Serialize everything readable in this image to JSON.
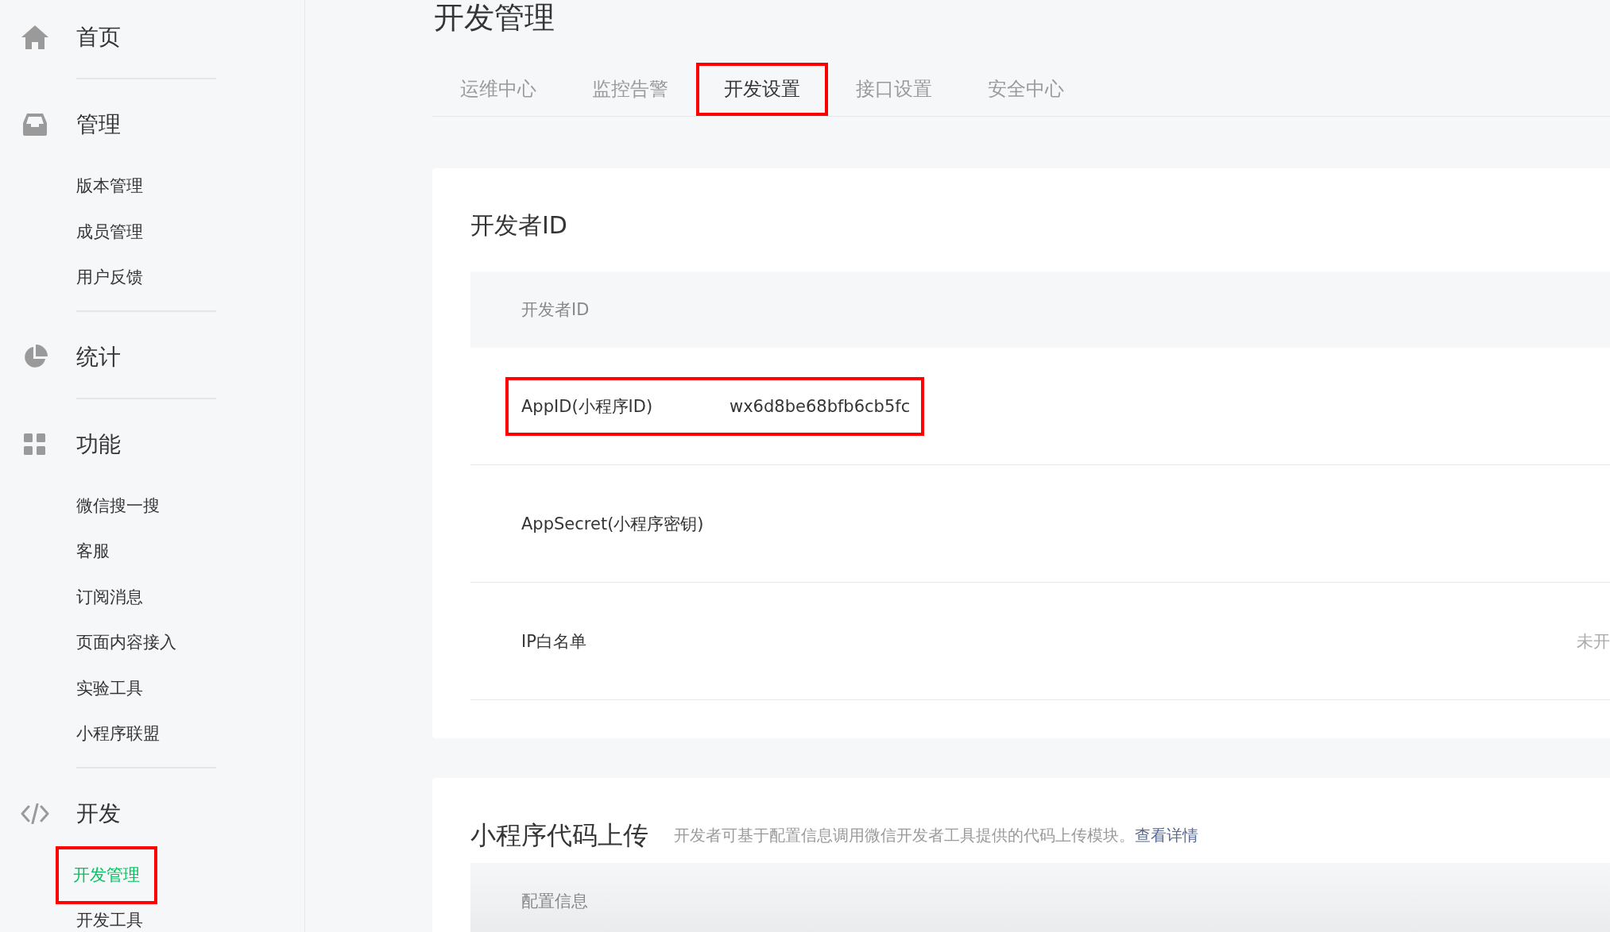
{
  "sidebar": {
    "groups": [
      {
        "title": "首页",
        "kind": "home"
      },
      {
        "title": "管理",
        "kind": "inbox",
        "items": [
          {
            "label": "版本管理",
            "selected": false,
            "highlighted": false
          },
          {
            "label": "成员管理",
            "selected": false,
            "highlighted": false
          },
          {
            "label": "用户反馈",
            "selected": false,
            "highlighted": false
          }
        ]
      },
      {
        "title": "统计",
        "kind": "pie"
      },
      {
        "title": "功能",
        "kind": "grid",
        "items": [
          {
            "label": "微信搜一搜",
            "selected": false,
            "highlighted": false
          },
          {
            "label": "客服",
            "selected": false,
            "highlighted": false
          },
          {
            "label": "订阅消息",
            "selected": false,
            "highlighted": false
          },
          {
            "label": "页面内容接入",
            "selected": false,
            "highlighted": false
          },
          {
            "label": "实验工具",
            "selected": false,
            "highlighted": false
          },
          {
            "label": "小程序联盟",
            "selected": false,
            "highlighted": false
          }
        ]
      },
      {
        "title": "开发",
        "kind": "code",
        "items": [
          {
            "label": "开发管理",
            "selected": true,
            "highlighted": true
          },
          {
            "label": "开发工具",
            "selected": false,
            "highlighted": false
          }
        ]
      }
    ]
  },
  "page": {
    "title": "开发管理",
    "tabs": [
      {
        "label": "运维中心",
        "selected": false,
        "highlighted": false
      },
      {
        "label": "监控告警",
        "selected": false,
        "highlighted": false
      },
      {
        "label": "开发设置",
        "selected": true,
        "highlighted": true
      },
      {
        "label": "接口设置",
        "selected": false,
        "highlighted": false
      },
      {
        "label": "安全中心",
        "selected": false,
        "highlighted": false
      }
    ],
    "developer_id": {
      "heading": "开发者ID",
      "section": "开发者ID",
      "rows": [
        {
          "label": "AppID(小程序ID)",
          "value": "wx6d8be68bfb6cb5fc",
          "highlighted": true
        },
        {
          "label": "AppSecret(小程序密钥)",
          "highlighted": false
        },
        {
          "label": "IP白名单",
          "status": "未开",
          "highlighted": false
        }
      ]
    },
    "code_upload": {
      "heading": "小程序代码上传",
      "description": "开发者可基于配置信息调用微信开发者工具提供的代码上传模块。",
      "link": "查看详情",
      "section": "配置信息"
    }
  }
}
